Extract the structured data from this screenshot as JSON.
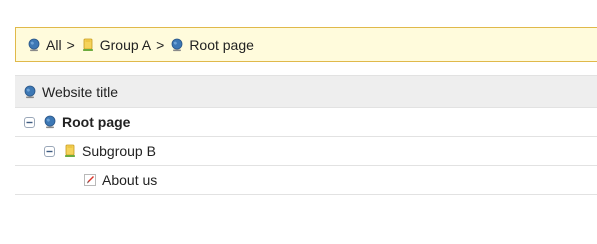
{
  "breadcrumb": {
    "items": [
      {
        "label": "All",
        "icon": "globe-icon"
      },
      {
        "label": "Group A",
        "icon": "folder-icon"
      },
      {
        "label": "Root page",
        "icon": "globe-icon"
      }
    ],
    "separator": ">"
  },
  "tree": {
    "header": {
      "label": "Website title",
      "icon": "globe-icon"
    },
    "rows": [
      {
        "label": "Root page",
        "icon": "globe-icon",
        "toggle": "collapse-icon",
        "level": 0
      },
      {
        "label": "Subgroup B",
        "icon": "folder-icon",
        "toggle": "collapse-icon",
        "level": 1
      },
      {
        "label": "About us",
        "icon": "page-edit-icon",
        "level": 2
      }
    ]
  },
  "colors": {
    "breadcrumb_bg": "#fffbdc",
    "breadcrumb_border": "#e0b94a",
    "header_bg": "#eeeeee",
    "divider": "#e2e2e2"
  }
}
